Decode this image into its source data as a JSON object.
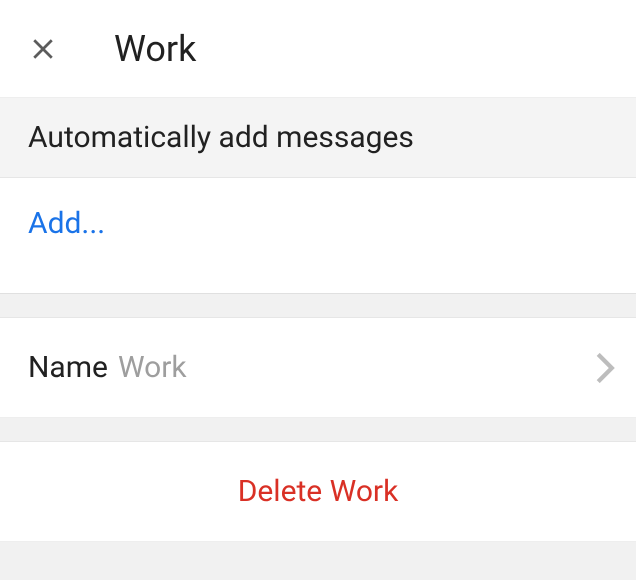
{
  "header": {
    "title": "Work"
  },
  "section": {
    "autoAddLabel": "Automatically add messages",
    "addLabel": "Add..."
  },
  "nameRow": {
    "label": "Name",
    "value": "Work"
  },
  "delete": {
    "label": "Delete Work"
  }
}
